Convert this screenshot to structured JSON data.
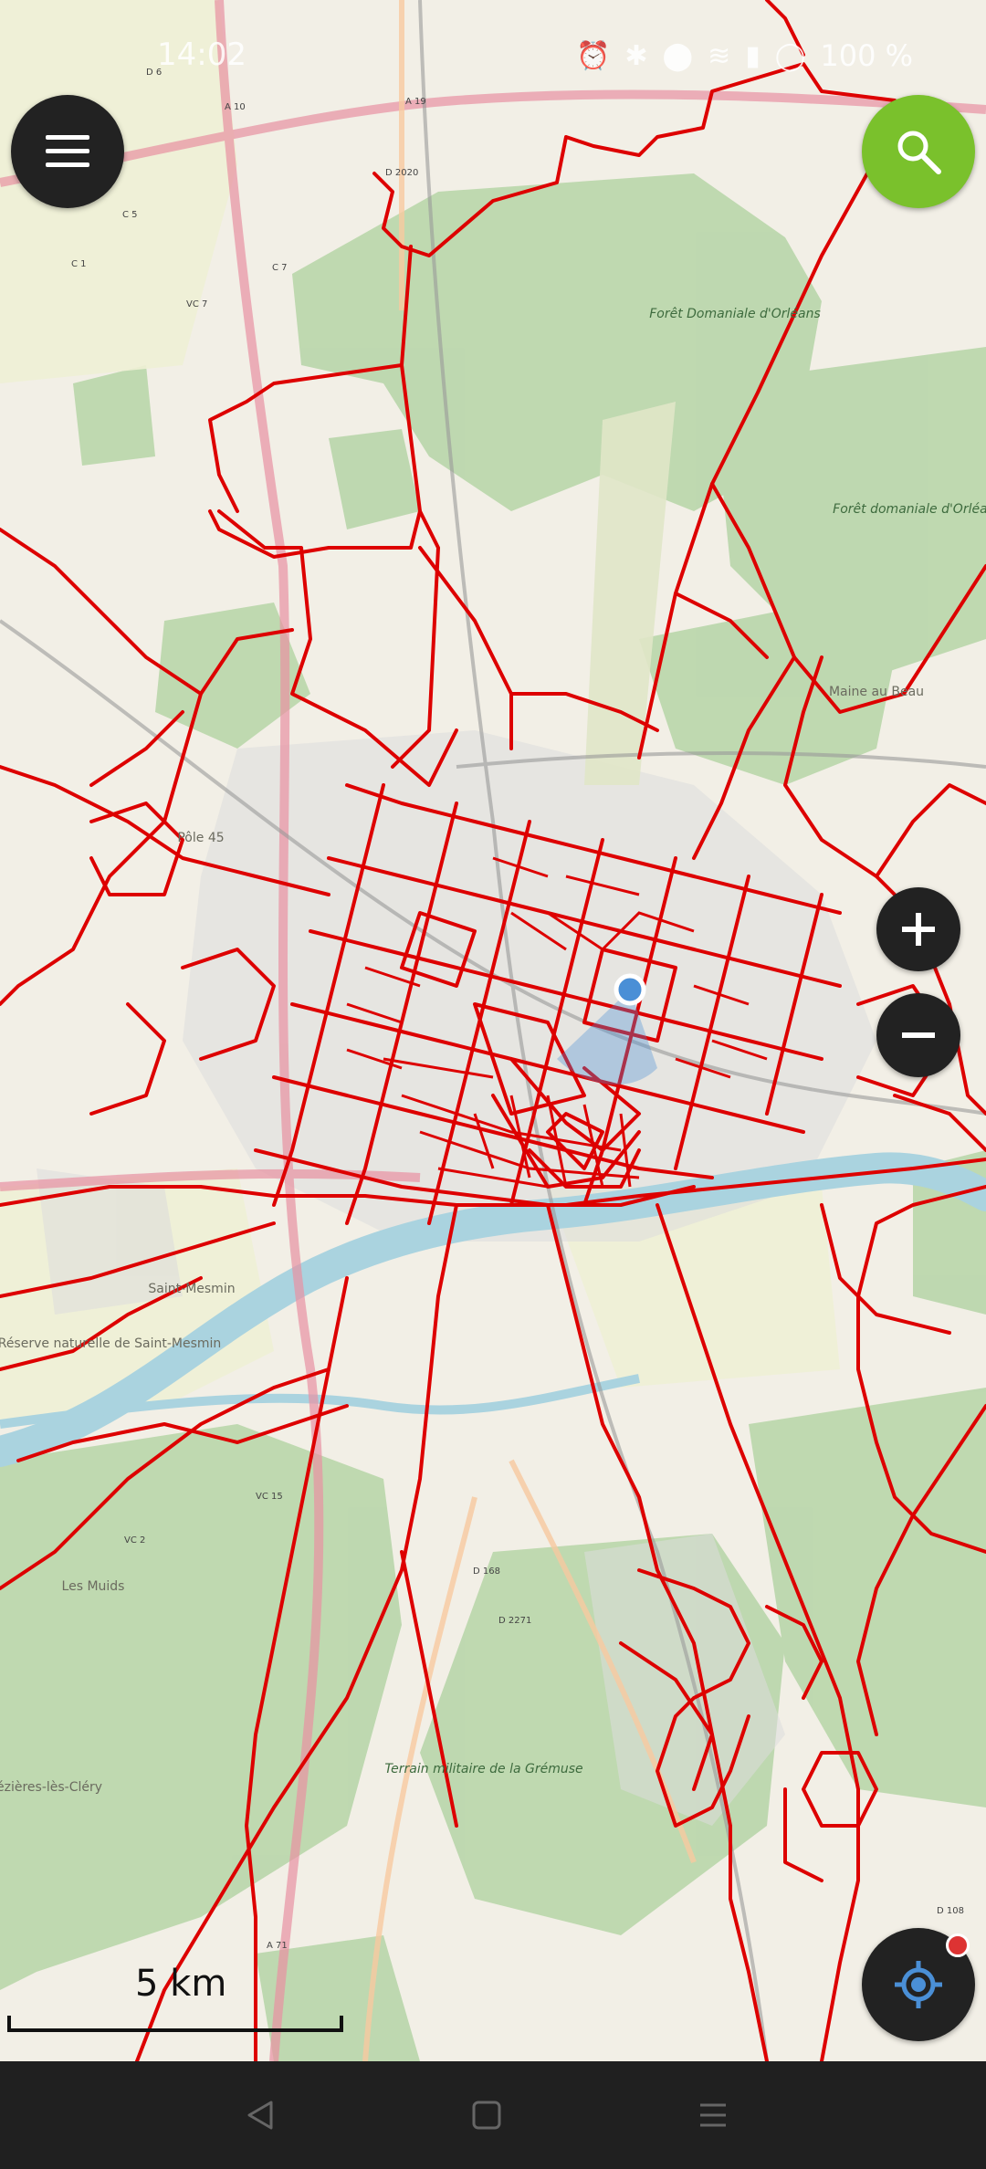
{
  "status_bar": {
    "time": "14:02",
    "battery": "100 %"
  },
  "map": {
    "scale_label": "5 km",
    "place_labels": [
      "Forêt Domaniale d'Orléans",
      "Forêt domaniale d'Orléans",
      "Terrain militaire de la Grémuse",
      "Les Muids",
      "Mézières-lès-Cléry",
      "Maine au Beau",
      "Pôle 45",
      "Saint-Mesmin",
      "Réserve naturelle de Saint-Mesmin"
    ],
    "road_refs": [
      "A 10",
      "A 19",
      "D 6",
      "C 5",
      "C 1",
      "C 7",
      "VC 7",
      "A 71",
      "D 168",
      "D 2271",
      "VC 15",
      "VC 2",
      "D 2020",
      "D 108"
    ]
  },
  "buttons": {
    "menu": "menu",
    "search": "search",
    "zoom_in": "+",
    "zoom_out": "−",
    "locate": "locate"
  },
  "colors": {
    "route": "#dd0000",
    "search_fab": "#7ac12c",
    "dark_fab": "#222222",
    "location_dot": "#4a8fd6"
  },
  "nav": {
    "back": "back",
    "home": "home",
    "recents": "recents"
  }
}
